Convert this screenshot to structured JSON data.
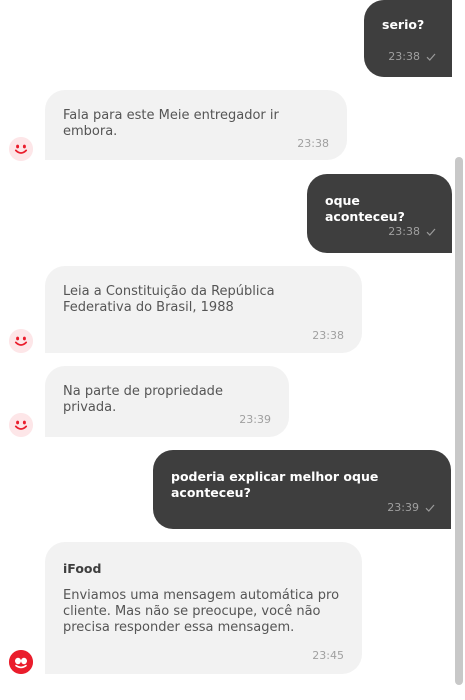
{
  "messages": [
    {
      "text": "serio?",
      "time": "23:38"
    },
    {
      "text": "Fala para este Meie entregador ir embora.",
      "time": "23:38"
    },
    {
      "text": "oque aconteceu?",
      "time": "23:38"
    },
    {
      "text": "Leia a Constituição da República Federativa do Brasil, 1988",
      "time": "23:38"
    },
    {
      "text": "Na parte de propriedade privada.",
      "time": "23:39"
    },
    {
      "text": "poderia explicar melhor oque aconteceu?",
      "time": "23:39"
    },
    {
      "sender": "iFood",
      "text": "Enviamos uma mensagem automática pro cliente. Mas não se preocupe, você não precisa responder essa mensagem.",
      "time": "23:45"
    }
  ],
  "icons": {
    "avatar_customer": "smiley-face-icon",
    "avatar_store": "ifood-logo-icon",
    "read_receipt": "check-icon"
  },
  "colors": {
    "outgoing_bubble": "#3e3e3e",
    "incoming_bubble": "#f2f2f2",
    "brand_red": "#ea1d2c",
    "avatar_bg": "#fde6e8"
  }
}
